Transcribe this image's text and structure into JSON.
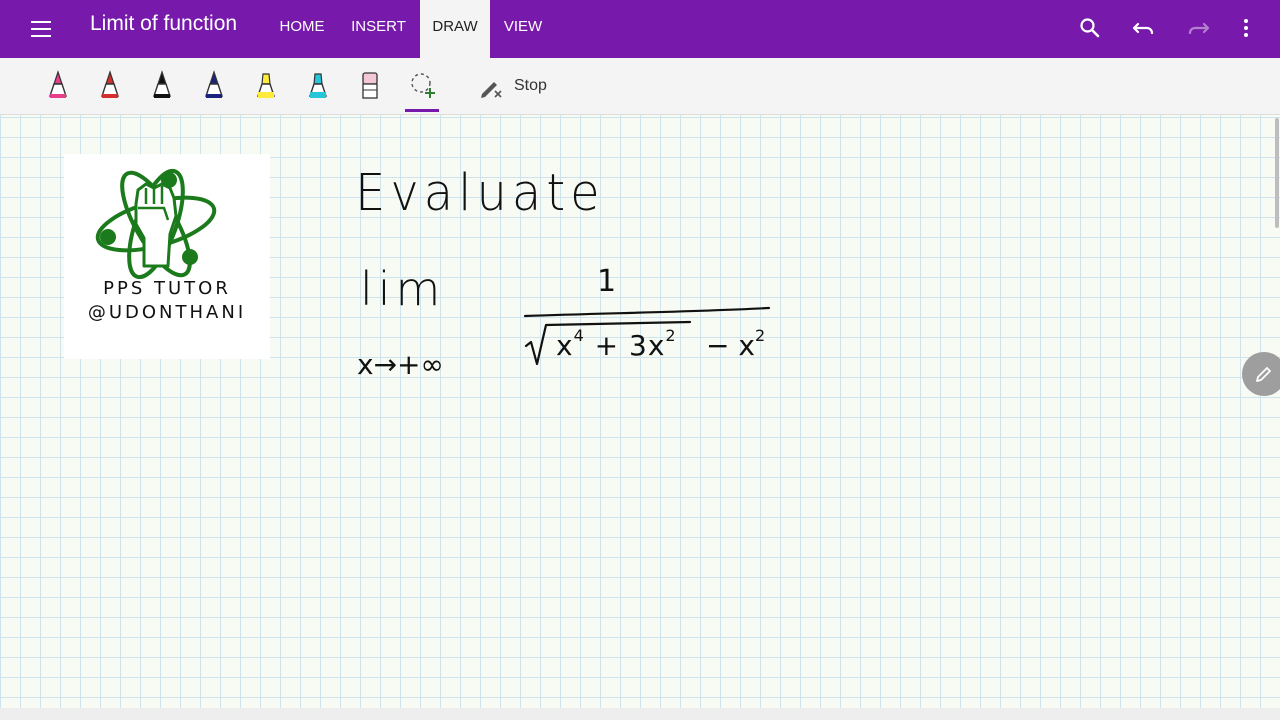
{
  "app": {
    "title": "Limit of function",
    "tabs": [
      {
        "label": "HOME"
      },
      {
        "label": "INSERT"
      },
      {
        "label": "DRAW",
        "active": true
      },
      {
        "label": "VIEW"
      }
    ],
    "accent_color": "#7719aa"
  },
  "header_icons": [
    "menu-icon",
    "search-icon",
    "undo-icon",
    "redo-icon",
    "more-vert-icon"
  ],
  "toolbar": {
    "pens": [
      {
        "name": "pink-pen",
        "color": "#e83e8c"
      },
      {
        "name": "red-pen",
        "color": "#d32f2f"
      },
      {
        "name": "black-pen",
        "color": "#111111"
      },
      {
        "name": "navy-pen",
        "color": "#1a237e"
      },
      {
        "name": "yellow-highlighter",
        "color": "#ffeb3b"
      },
      {
        "name": "cyan-highlighter",
        "color": "#26c6da"
      },
      {
        "name": "eraser",
        "color": "#f3c7d6"
      }
    ],
    "lasso": "lasso-select-icon",
    "stop_label": "Stop"
  },
  "logo": {
    "line1": "PPS TUTOR",
    "line2": "@UDONTHANI"
  },
  "handwriting": {
    "heading": "Evaluate",
    "lim": "lim",
    "approach": "x→+∞",
    "numerator": "1",
    "radicand_base1": "x",
    "radicand_exp1": "4",
    "radicand_mid": " + 3x",
    "radicand_exp2": "2",
    "tail_base": " − x",
    "tail_exp": "2"
  }
}
